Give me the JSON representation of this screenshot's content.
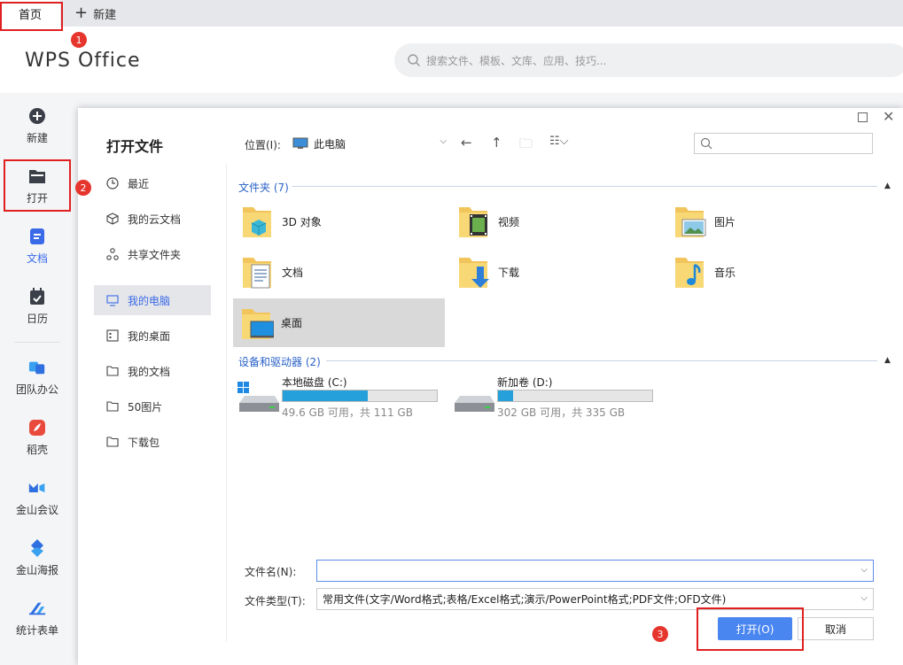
{
  "tabs": {
    "home": "首页",
    "new": "新建"
  },
  "header": {
    "logo": "WPS Office",
    "search_placeholder": "搜索文件、模板、文库、应用、技巧..."
  },
  "leftnav": [
    {
      "label": "新建",
      "icon": "plus-circle-icon"
    },
    {
      "label": "打开",
      "icon": "folder-icon"
    },
    {
      "label": "文档",
      "icon": "document-icon",
      "active": true
    },
    {
      "label": "日历",
      "icon": "calendar-icon"
    },
    {
      "label": "团队办公",
      "icon": "team-icon"
    },
    {
      "label": "稻壳",
      "icon": "docer-icon"
    },
    {
      "label": "金山会议",
      "icon": "meeting-icon"
    },
    {
      "label": "金山海报",
      "icon": "poster-icon"
    },
    {
      "label": "统计表单",
      "icon": "form-icon"
    }
  ],
  "markers": [
    "1",
    "2",
    "3"
  ],
  "dialog": {
    "title": "打开文件",
    "location_label": "位置(I):",
    "location_value": "此电脑",
    "sidebar": [
      {
        "label": "最近",
        "icon": "clock-icon"
      },
      {
        "label": "我的云文档",
        "icon": "cloud-cube-icon"
      },
      {
        "label": "共享文件夹",
        "icon": "share-icon"
      },
      {
        "label": "我的电脑",
        "icon": "monitor-icon",
        "active": true
      },
      {
        "label": "我的桌面",
        "icon": "desktop-icon"
      },
      {
        "label": "我的文档",
        "icon": "folder-outline-icon"
      },
      {
        "label": "50图片",
        "icon": "folder-outline-icon"
      },
      {
        "label": "下载包",
        "icon": "folder-outline-icon"
      }
    ],
    "folders_header": "文件夹 (7)",
    "folders": [
      {
        "name": "3D 对象",
        "icon": "folder-3d-icon"
      },
      {
        "name": "视频",
        "icon": "folder-video-icon"
      },
      {
        "name": "图片",
        "icon": "folder-picture-icon"
      },
      {
        "name": "文档",
        "icon": "folder-document-icon"
      },
      {
        "name": "下载",
        "icon": "folder-download-icon"
      },
      {
        "name": "音乐",
        "icon": "folder-music-icon"
      },
      {
        "name": "桌面",
        "icon": "folder-desktop-icon",
        "selected": true
      }
    ],
    "drives_header": "设备和驱动器 (2)",
    "drives": [
      {
        "name": "本地磁盘 (C:)",
        "info": "49.6 GB 可用，共 111 GB",
        "used_fraction": 0.553,
        "icon": "windows-drive-icon"
      },
      {
        "name": "新加卷 (D:)",
        "info": "302 GB 可用，共 335 GB",
        "used_fraction": 0.099,
        "icon": "drive-icon"
      }
    ],
    "filename_label": "文件名(N):",
    "filename_value": "",
    "filetype_label": "文件类型(T):",
    "filetype_value": "常用文件(文字/Word格式;表格/Excel格式;演示/PowerPoint格式;PDF文件;OFD文件)",
    "open_button": "打开(O)",
    "cancel_button": "取消"
  },
  "colors": {
    "accent": "#3a6ae8",
    "button": "#4a86f0",
    "annotation": "#e02020",
    "selected": "#d9d9d9"
  }
}
